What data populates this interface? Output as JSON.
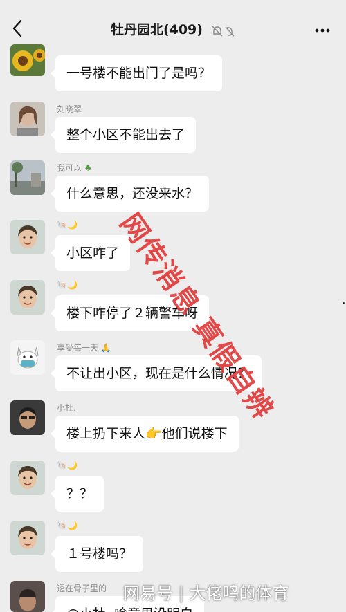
{
  "header": {
    "title": "牡丹园北(409)",
    "back_icon": "back-arrow-icon",
    "mute_icon": "mute-bell-icon",
    "more_icon": "more-dots-icon"
  },
  "messages": [
    {
      "sender": "",
      "text": "一号楼不能出门了是吗？",
      "avatar": "sunflower"
    },
    {
      "sender": "刘晓翠",
      "text": "整个小区不能出去了",
      "avatar": "woman-photo"
    },
    {
      "sender": "我可以",
      "text": "什么意思，还没来水？",
      "avatar": "street-photo"
    },
    {
      "sender": "",
      "text": "小区咋了",
      "avatar": "child-photo"
    },
    {
      "sender": "",
      "text": "楼下咋停了２辆警车呀",
      "avatar": "child-photo"
    },
    {
      "sender": "享受每一天",
      "text": "不让出小区，现在是什么情况？",
      "avatar": "cartoon-dog"
    },
    {
      "sender": "小杜.",
      "text": "楼上扔下来人👉他们说楼下",
      "avatar": "man-photo"
    },
    {
      "sender": "",
      "text": "？？",
      "avatar": "child-photo"
    },
    {
      "sender": "",
      "text": "１号楼吗？",
      "avatar": "child-photo"
    },
    {
      "sender": "透在骨子里的",
      "text": "@小杜. 啥意思没明白",
      "avatar": "man-photo"
    }
  ],
  "overlay": {
    "watermark": "网传消息 真假自辨",
    "watermark_color": "#e03c3c",
    "footer": "网易号 | 大佬鸣的体育"
  }
}
